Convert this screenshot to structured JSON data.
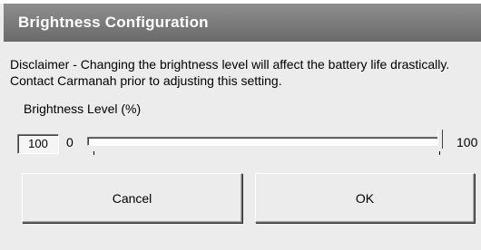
{
  "window": {
    "title": "Brightness Configuration"
  },
  "disclaimer": {
    "line1": "Disclaimer - Changing the brightness level will affect the battery life drastically.",
    "line2": " Contact Carmanah prior to adjusting this setting."
  },
  "slider": {
    "label": "Brightness Level (%)",
    "value": "100",
    "min_label": "0",
    "max_label": "100",
    "level_fraction": 1.0
  },
  "buttons": {
    "cancel_label": "Cancel",
    "ok_label": "OK"
  },
  "colors": {
    "titlebar": "#7a7a7a",
    "dialog_bg": "#ececec"
  }
}
